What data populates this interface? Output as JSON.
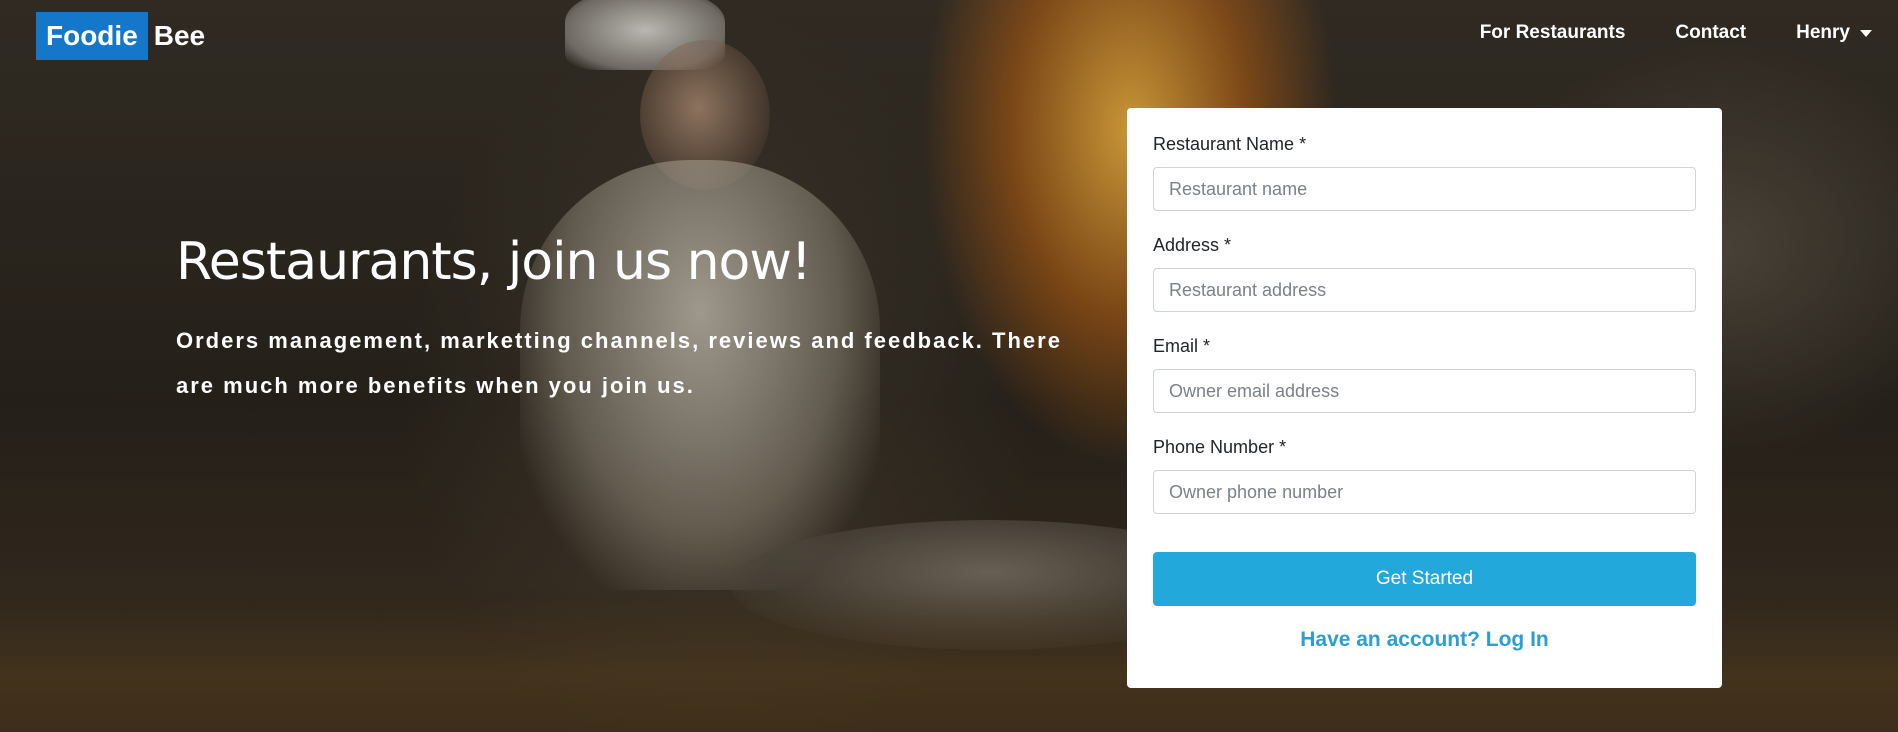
{
  "navbar": {
    "brand_box": "Foodie",
    "brand_rest": "Bee",
    "links": [
      {
        "label": "For Restaurants"
      },
      {
        "label": "Contact"
      },
      {
        "label": "Henry"
      }
    ]
  },
  "hero": {
    "title": "Restaurants, join us now!",
    "subtitle": "Orders management, marketting channels, reviews and feedback. There are much more benefits when you join us."
  },
  "form": {
    "fields": [
      {
        "label": "Restaurant Name *",
        "placeholder": "Restaurant name",
        "value": ""
      },
      {
        "label": "Address *",
        "placeholder": "Restaurant address",
        "value": ""
      },
      {
        "label": "Email *",
        "placeholder": "Owner email address",
        "value": ""
      },
      {
        "label": "Phone Number *",
        "placeholder": "Owner phone number",
        "value": ""
      }
    ],
    "submit_label": "Get Started",
    "login_label": "Have an account? Log In"
  },
  "colors": {
    "brand": "#1477c9",
    "button": "#22a8da",
    "link": "#2a9fd0"
  }
}
